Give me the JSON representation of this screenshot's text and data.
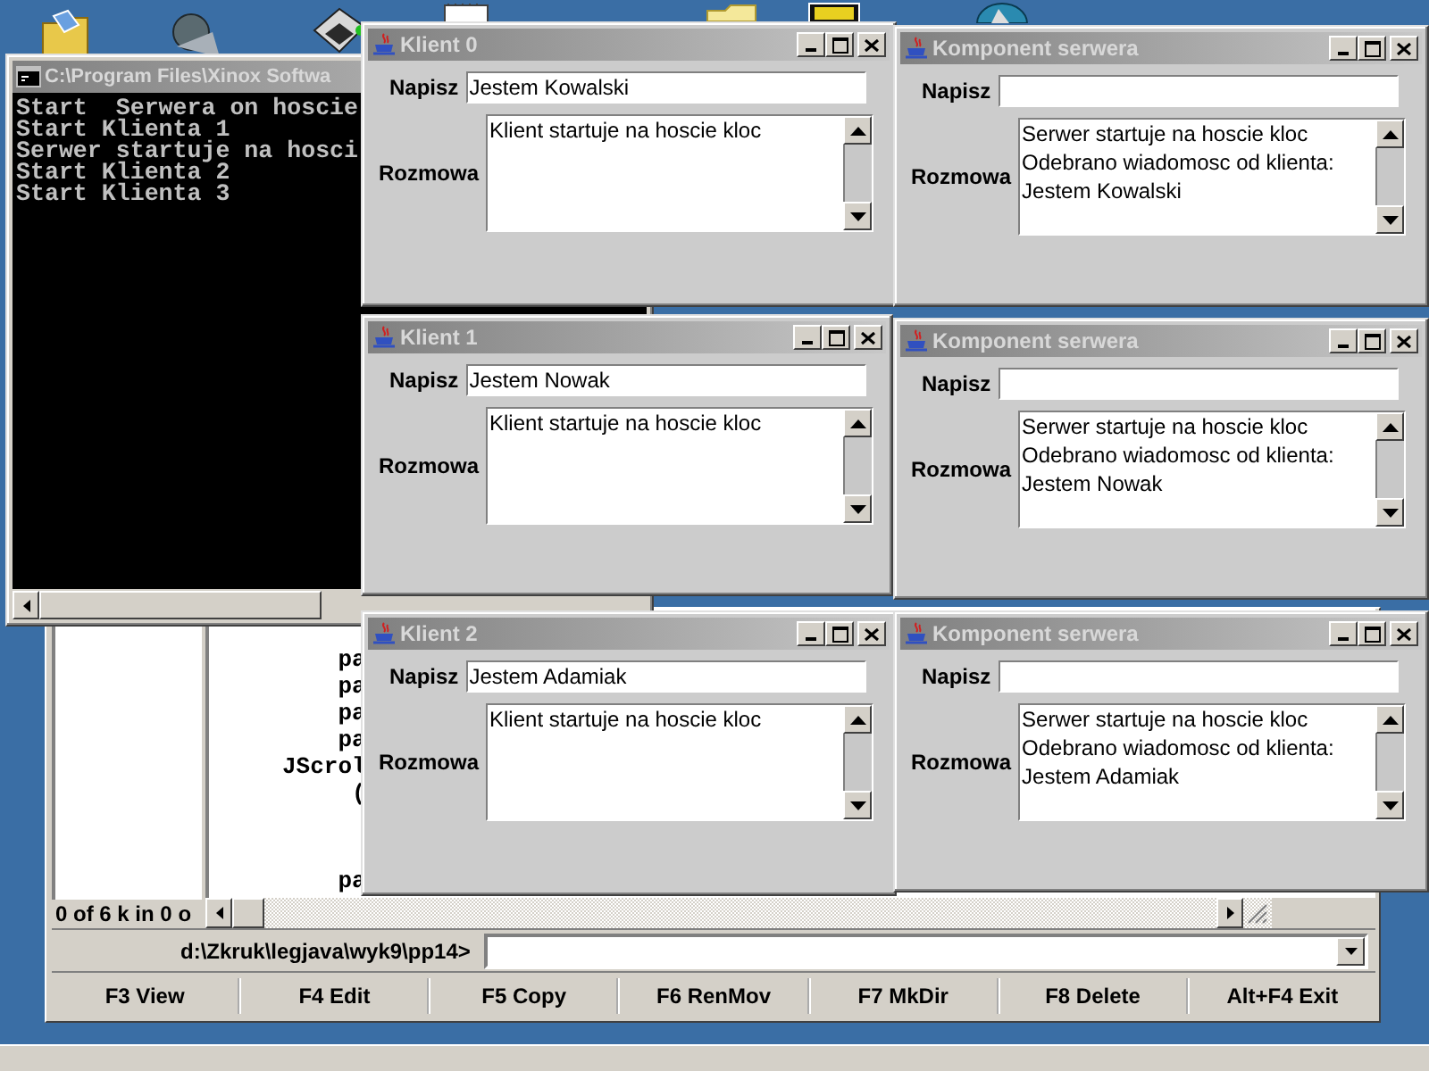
{
  "console_window": {
    "title": "C:\\Program Files\\Xinox Softwa",
    "lines": [
      "Start  Serwera on hoscie",
      "Start Klienta 1",
      "Serwer startuje na hosci",
      "Start Klienta 2",
      "Start Klienta 3"
    ]
  },
  "file_manager": {
    "code_lines": [
      "         pa",
      "         pa",
      "         pa",
      "         pa",
      "     JScrol",
      "          (",
      "         pa"
    ],
    "status": "0 of 6 k in 0 o",
    "prompt": "d:\\Zkruk\\legjava\\wyk9\\pp14>",
    "function_keys": [
      "F3 View",
      "F4 Edit",
      "F5 Copy",
      "F6 RenMov",
      "F7 MkDir",
      "F8 Delete",
      "Alt+F4 Exit"
    ]
  },
  "chat_windows": [
    {
      "title": "Klient 0",
      "write_label": "Napisz",
      "input_value": "Jestem Kowalski",
      "chat_label": "Rozmowa",
      "messages": [
        "Klient startuje na hoscie kloc"
      ]
    },
    {
      "title": "Komponent serwera",
      "write_label": "Napisz",
      "chat_label": "Rozmowa",
      "messages": [
        "Serwer startuje na hoscie kloc",
        "Odebrano wiadomosc od klienta:",
        "Jestem Kowalski"
      ]
    },
    {
      "title": "Klient 1",
      "write_label": "Napisz",
      "input_value": "Jestem Nowak",
      "chat_label": "Rozmowa",
      "messages": [
        "Klient startuje na hoscie kloc"
      ]
    },
    {
      "title": "Komponent serwera",
      "write_label": "Napisz",
      "chat_label": "Rozmowa",
      "messages": [
        "Serwer startuje na hoscie kloc",
        "Odebrano wiadomosc od klienta:",
        "Jestem Nowak"
      ]
    },
    {
      "title": "Klient 2",
      "write_label": "Napisz",
      "input_value": "Jestem Adamiak",
      "chat_label": "Rozmowa",
      "messages": [
        "Klient startuje na hoscie kloc"
      ]
    },
    {
      "title": "Komponent serwera",
      "write_label": "Napisz",
      "chat_label": "Rozmowa",
      "messages": [
        "Serwer startuje na hoscie kloc",
        "Odebrano wiadomosc od klienta:",
        "Jestem Adamiak"
      ]
    }
  ]
}
